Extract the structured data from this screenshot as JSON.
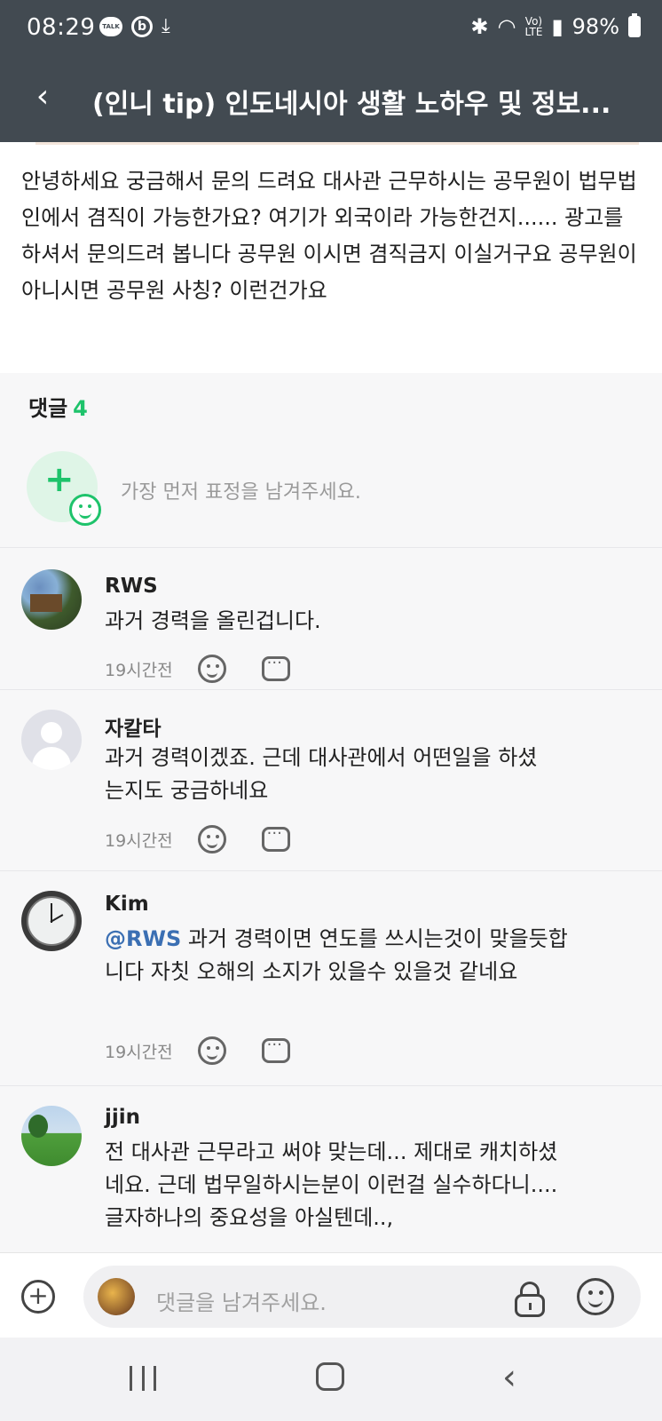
{
  "status_bar": {
    "time": "08:29",
    "talk_badge": "TALK",
    "b_badge": "b",
    "battery": "98%",
    "volte_top": "Vo)",
    "volte_bottom": "LTE"
  },
  "header": {
    "title": "(인니 tip) 인도네시아 생활 노하우 및 정보..."
  },
  "post": {
    "body": "안녕하세요 궁금해서 문의 드려요 대사관 근무하시는 공무원이 법무법인에서 겸직이 가능한가요? 여기가 외국이라 가능한건지...... 광고를 하셔서 문의드려 봅니다 공무원 이시면 겸직금지 이실거구요 공무원이 아니시면 공무원 사칭? 이런건가요"
  },
  "comments_section": {
    "label": "댓글",
    "count": "4",
    "reaction_placeholder": "가장 먼저 표정을 남겨주세요."
  },
  "comments": [
    {
      "author": "RWS",
      "mention": "",
      "text": "과거 경력을 올린겁니다.",
      "time": "19시간전"
    },
    {
      "author": "자칼타",
      "mention": "",
      "text": "과거 경력이겠죠. 근데 대사관에서 어떤일을 하셨는지도 궁금하네요",
      "time": "19시간전"
    },
    {
      "author": "Kim",
      "mention": "@RWS",
      "text": " 과거 경력이면 연도를 쓰시는것이 맞을듯합니다 자칫 오해의 소지가 있을수 있을것 같네요",
      "time": "19시간전"
    },
    {
      "author": "jjin",
      "mention": "",
      "text": "전 대사관 근무라고 써야 맞는데...  제대로 캐치하셨네요. 근데 법무일하시는분이 이런걸 실수하다니.... 글자하나의 중요성을 아실텐데..,",
      "time": ""
    }
  ],
  "input_bar": {
    "placeholder": "댓글을 남겨주세요."
  },
  "colors": {
    "header_bg": "#424a51",
    "accent_green": "#1ec36b",
    "mention_blue": "#3b6fb3"
  }
}
